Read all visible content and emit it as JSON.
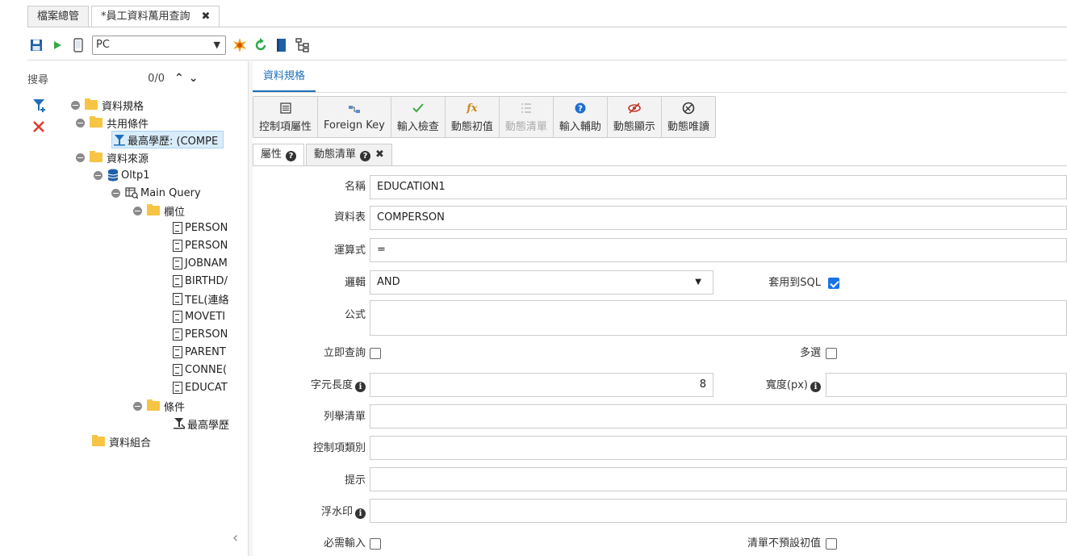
{
  "top_tabs": [
    {
      "label": "檔案總管"
    },
    {
      "label": "*員工資料萬用查詢",
      "close": "✖"
    }
  ],
  "toolbar": {
    "platform_value": "PC",
    "icons": [
      "save-icon",
      "run-icon",
      "device-icon",
      "settings-burst-icon",
      "refresh-icon",
      "book-icon",
      "tree-structure-icon"
    ]
  },
  "search": {
    "label": "搜尋",
    "count": "0/0"
  },
  "tree": {
    "root": "資料規格",
    "shared_conditions": "共用條件",
    "selected_condition": "最高學歷: (COMPE",
    "data_source": "資料來源",
    "oltp": "Oltp1",
    "main_query": "Main Query",
    "fields": "欄位",
    "field_items": [
      "PERSON",
      "PERSON",
      "JOBNAM",
      "BIRTHD/",
      "TEL(連絡",
      "MOVETI",
      "PERSON",
      "PARENT",
      "CONNE(",
      "EDUCAT"
    ],
    "conditions": "條件",
    "condition_item": "最高學歷",
    "data_combo": "資料組合"
  },
  "spec_tab": "資料規格",
  "actions": [
    {
      "label": "控制項屬性",
      "icon": "control-properties-icon",
      "disabled": false
    },
    {
      "label": "Foreign Key",
      "icon": "foreign-key-icon",
      "disabled": false
    },
    {
      "label": "輸入檢查",
      "icon": "check-icon",
      "disabled": false
    },
    {
      "label": "動態初值",
      "icon": "function-icon",
      "disabled": false
    },
    {
      "label": "動態清單",
      "icon": "list-icon",
      "disabled": true
    },
    {
      "label": "輸入輔助",
      "icon": "help-circle-icon",
      "disabled": false
    },
    {
      "label": "動態顯示",
      "icon": "eye-slash-icon",
      "disabled": false
    },
    {
      "label": "動態唯讀",
      "icon": "no-edit-icon",
      "disabled": false
    }
  ],
  "sub_tabs": [
    {
      "label": "屬性",
      "active": true
    },
    {
      "label": "動態清單",
      "active": false,
      "close": "✖"
    }
  ],
  "form": {
    "name_label": "名稱",
    "name_value": "EDUCATION1",
    "table_label": "資料表",
    "table_value": "COMPERSON",
    "operator_label": "運算式",
    "operator_value": "=",
    "logic_label": "邏輯",
    "logic_value": "AND",
    "apply_sql_label": "套用到SQL",
    "apply_sql_checked": true,
    "formula_label": "公式",
    "formula_value": "",
    "instant_query_label": "立即查詢",
    "instant_query_checked": false,
    "multi_select_label": "多選",
    "multi_select_checked": false,
    "char_length_label": "字元長度",
    "char_length_value": "8",
    "width_label": "寬度(px)",
    "width_value": "",
    "enum_list_label": "列舉清單",
    "control_type_label": "控制項類別",
    "hint_label": "提示",
    "watermark_label": "浮水印",
    "required_label": "必需輸入",
    "required_checked": false,
    "no_default_label": "清單不預設初值",
    "no_default_checked": false
  },
  "colors": {
    "accent": "#1c6fb8",
    "selected_bg": "#d9ecfa",
    "folder": "#f7c444",
    "delete": "#e03c31",
    "checkbox_checked": "#1a73e8"
  }
}
